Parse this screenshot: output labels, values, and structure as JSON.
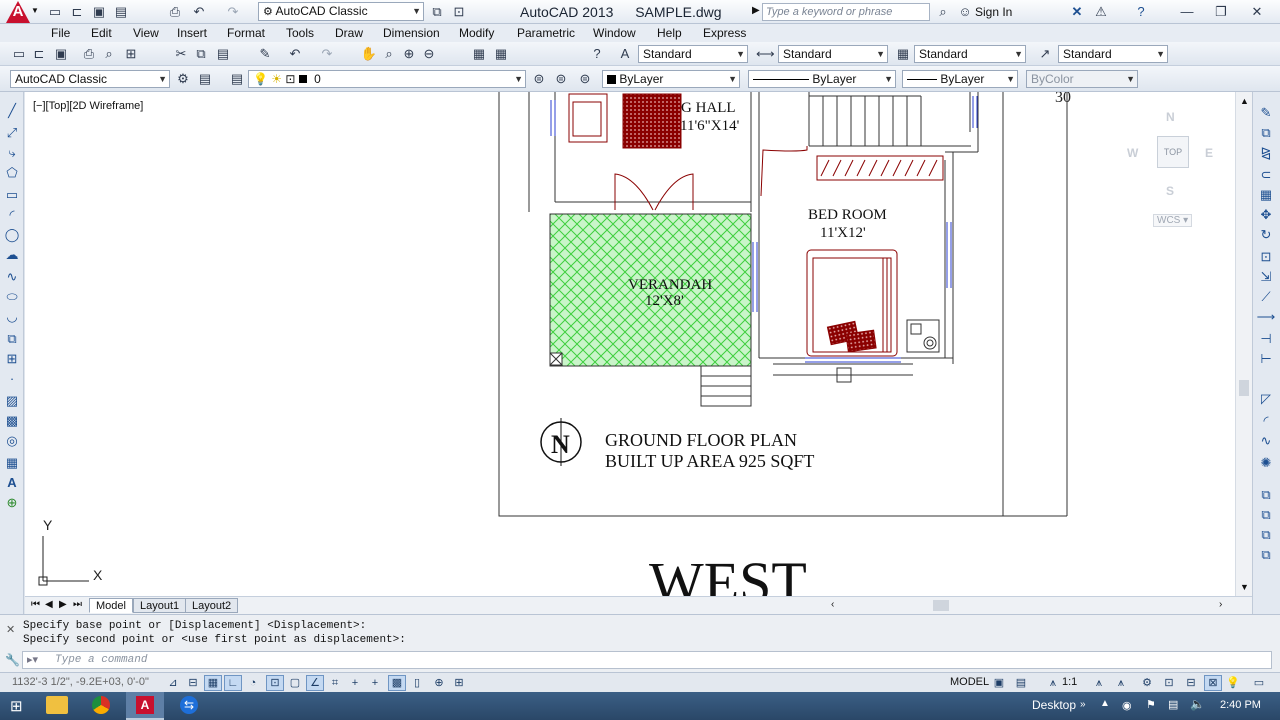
{
  "titlebar": {
    "app_logo": "A",
    "workspace": "AutoCAD Classic",
    "title": "AutoCAD 2013",
    "filename": "SAMPLE.dwg",
    "search_placeholder": "Type a keyword or phrase",
    "sign_in": "Sign In"
  },
  "menu": [
    "File",
    "Edit",
    "View",
    "Insert",
    "Format",
    "Tools",
    "Draw",
    "Dimension",
    "Modify",
    "Parametric",
    "Window",
    "Help",
    "Express"
  ],
  "styles": {
    "text_style": "Standard",
    "dim_style": "Standard",
    "table_style": "Standard",
    "mleader_style": "Standard"
  },
  "layers": {
    "workspace": "AutoCAD Classic",
    "current_layer": "0",
    "color": "ByLayer",
    "linetype": "ByLayer",
    "lineweight": "ByLayer",
    "plotstyle": "ByColor"
  },
  "viewport": {
    "label": "[−][Top][2D Wireframe]",
    "viewcube_top": "TOP",
    "compass_n": "N",
    "compass_s": "S",
    "compass_e": "E",
    "compass_w": "W",
    "wcs": "WCS ▾",
    "ucs_x": "X",
    "ucs_y": "Y"
  },
  "drawing": {
    "room_dining": "G HALL",
    "room_dining_size": "11'6\"X14'",
    "room_bed": "BED ROOM",
    "room_bed_size": "11'X12'",
    "room_verandah": "VERANDAH",
    "room_verandah_size": "12'X8'",
    "plan_title": "GROUND FLOOR PLAN",
    "plan_area": "BUILT UP AREA 925 SQFT",
    "north_label": "N",
    "dim_partial": "30",
    "west_label": "WEST"
  },
  "layout_tabs": [
    "Model",
    "Layout1",
    "Layout2"
  ],
  "command": {
    "line1": "Specify base point or [Displacement] <Displacement>:",
    "line2": "Specify second point or <use first point as displacement>:",
    "placeholder": "Type a command"
  },
  "status": {
    "coords": "1132'-3 1/2\", -9.2E+03, 0'-0\"",
    "model": "MODEL",
    "scale": "1:1"
  },
  "taskbar": {
    "desktop": "Desktop",
    "time": "2:40 PM"
  }
}
